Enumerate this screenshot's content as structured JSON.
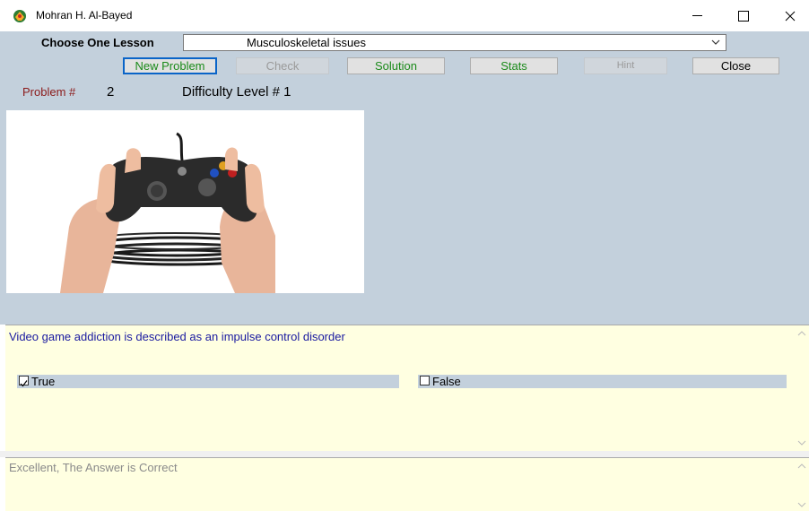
{
  "window": {
    "title": "Mohran H. Al-Bayed",
    "minimize": "—",
    "maximize": "☐",
    "close": "✕"
  },
  "lesson": {
    "label": "Choose One Lesson",
    "selected": "Musculoskeletal issues"
  },
  "toolbar": {
    "new_problem": "New Problem",
    "check": "Check",
    "solution": "Solution",
    "stats": "Stats",
    "hint": "Hint",
    "close": "Close"
  },
  "problem": {
    "label": "Problem #",
    "number": "2",
    "difficulty": "Difficulty Level # 1"
  },
  "image": {
    "icon": "game-controller-hands-cable-image"
  },
  "question": {
    "text": "Video game addiction is described as an impulse control disorder",
    "options": [
      {
        "label": "True",
        "checked": true
      },
      {
        "label": "False",
        "checked": false
      }
    ]
  },
  "feedback": {
    "text": "Excellent, The Answer is Correct"
  },
  "colors": {
    "main_bg": "#c3d0dc",
    "panel_bg": "#ffffe1",
    "green_text": "#1a8a1a",
    "problem_label": "#8b1a1a",
    "question_text": "#1a1aa0"
  }
}
